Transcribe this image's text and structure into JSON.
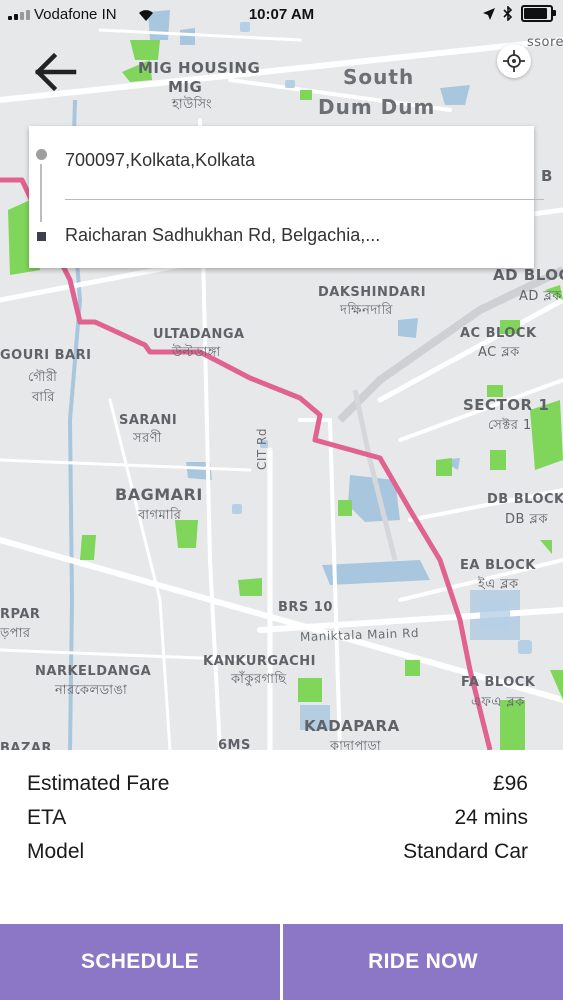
{
  "status_bar": {
    "carrier": "Vodafone IN",
    "time": "10:07 AM",
    "battery_percent": 90
  },
  "map": {
    "labels": {
      "mig_housing": "MIG HOUSING",
      "mig": "MIG",
      "mig_bn": "হাউসিং",
      "south_dum_dum_1": "South",
      "south_dum_dum_2": "Dum Dum",
      "b_fragment": "B",
      "ad_block": "AD BLOCK",
      "ad_block_bn": "AD ব্লক",
      "dakshindari": "DAKSHINDARI",
      "dakshindari_bn": "দক্ষিনদারি",
      "ultadanga": "ULTADANGA",
      "ultadanga_bn": "উল্টডাঙ্গা",
      "ac_block": "AC BLOCK",
      "ac_block_bn": "AC ব্লক",
      "gouri_bari": "GOURI BARI",
      "gouri_bn_1": "গৌরী",
      "gouri_bn_2": "বারি",
      "sector_1": "SECTOR 1",
      "sector_1_bn": "সেক্টর 1",
      "sarani": "SARANI",
      "sarani_bn": "সরণী",
      "cit_rd": "CIT Rd",
      "bagmari": "BAGMARI",
      "bagmari_bn": "বাগমারি",
      "db_block": "DB BLOCK",
      "db_block_bn": "DB ব্লক",
      "ea_block": "EA BLOCK",
      "ea_block_bn": "ইএ ব্লক",
      "rpar": "RPAR",
      "rpar_bn": "ড়পার",
      "brs_10": "BRS 10",
      "maniktala": "Maniktala Main Rd",
      "narkeldanga": "NARKELDANGA",
      "narkeldanga_bn": "নারকেলডাঙা",
      "kankurgachi": "KANKURGACHI",
      "kankurgachi_bn": "কাঁকুরগাছি",
      "fa_block": "FA BLOCK",
      "fa_block_bn": "এফএ ব্লক",
      "kadapara": "KADAPARA",
      "bazar": "BAZAR",
      "sixms": "6MS",
      "kadapara_bn": "কাদাপাড়া",
      "ssore": "ssore"
    }
  },
  "trip": {
    "origin": "700097,Kolkata,Kolkata",
    "destination": "Raicharan Sadhukhan Rd, Belgachia,..."
  },
  "fare_details": [
    {
      "label": "Estimated Fare",
      "value": "£96"
    },
    {
      "label": "ETA",
      "value": "24 mins"
    },
    {
      "label": "Model",
      "value": "Standard Car"
    }
  ],
  "actions": {
    "schedule": "SCHEDULE",
    "ride_now": "RIDE NOW"
  },
  "colors": {
    "accent": "#8c77c7",
    "route": "#e0628e",
    "park": "#7fd65a",
    "water": "#a7c7e0"
  }
}
